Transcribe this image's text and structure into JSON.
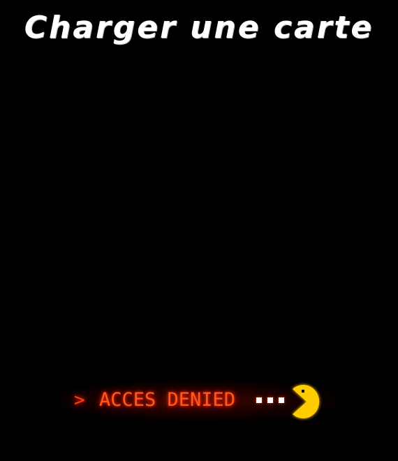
{
  "screen": {
    "title": "Charger une carte"
  },
  "status_message": {
    "prompt": ">",
    "text": "ACCES DENIED",
    "dot_count": 3,
    "icon": "pacman-icon"
  },
  "colors": {
    "background": "#000000",
    "title": "#ffffff",
    "message": "#ff5a1c",
    "glow": "#ff2a00",
    "pacman": "#ffcc00"
  }
}
